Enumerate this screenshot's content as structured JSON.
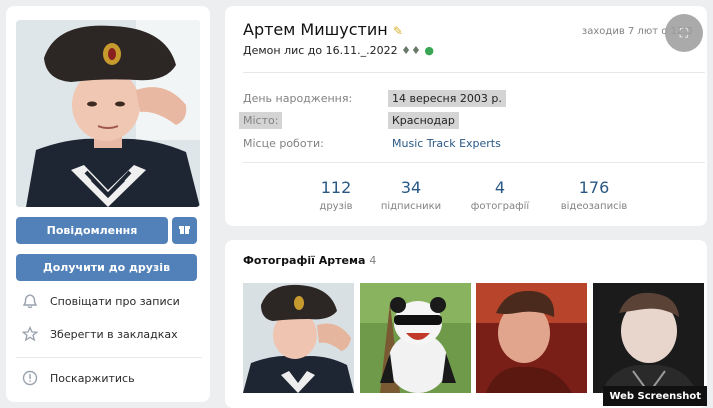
{
  "sidebar": {
    "message_button": "Повідомлення",
    "add_friend_button": "Долучити до друзів",
    "menu": [
      {
        "label": "Сповіщати про записи",
        "icon": "bell-icon"
      },
      {
        "label": "Зберегти в закладках",
        "icon": "star-icon"
      },
      {
        "label": "Поскаржитись",
        "icon": "warning-icon"
      }
    ]
  },
  "profile": {
    "name": "Артем Мишустин",
    "status": "Демон лис до 16.11._.2022",
    "last_seen": "заходив 7 лют о 12:5",
    "info": [
      {
        "label": "День народження:",
        "value": "14 вересня 2003 р."
      },
      {
        "label": "Місто:",
        "value": "Краснодар"
      },
      {
        "label": "Місце роботи:",
        "value": "Music Track Experts"
      }
    ],
    "counters": [
      {
        "num": "112",
        "label": "друзів"
      },
      {
        "num": "34",
        "label": "підписники"
      },
      {
        "num": "4",
        "label": "фотографії"
      },
      {
        "num": "176",
        "label": "відеозаписів"
      }
    ]
  },
  "photos": {
    "title": "Фотографії Артема",
    "count": "4"
  },
  "watermark": "Web Screenshot",
  "colors": {
    "accent": "#5181b8",
    "link": "#2a5885",
    "background": "#edeef0"
  }
}
